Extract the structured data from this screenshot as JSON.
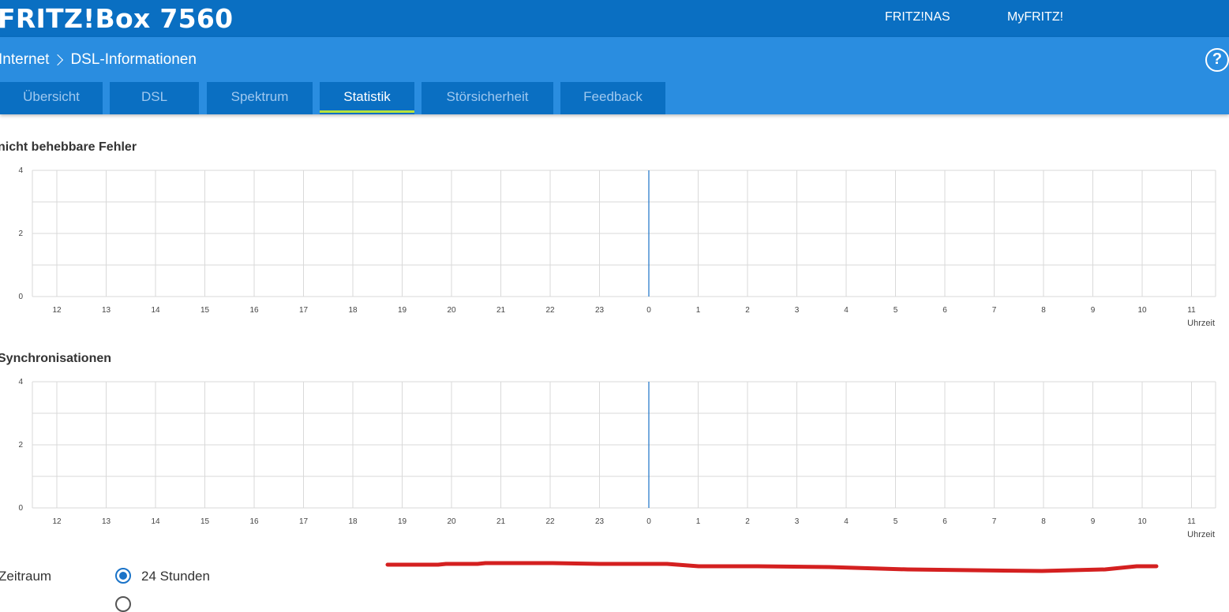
{
  "header": {
    "brand": "FRITZ!Box 7560",
    "links": [
      "FRITZ!NAS",
      "MyFRITZ!"
    ]
  },
  "breadcrumb": {
    "parent": "Internet",
    "current": "DSL-Informationen"
  },
  "help": {
    "label": "?"
  },
  "tabs": [
    {
      "label": "Übersicht",
      "active": false
    },
    {
      "label": "DSL",
      "active": false
    },
    {
      "label": "Spektrum",
      "active": false
    },
    {
      "label": "Statistik",
      "active": true
    },
    {
      "label": "Störsicherheit",
      "active": false
    },
    {
      "label": "Feedback",
      "active": false
    }
  ],
  "sections": {
    "errors_title": "nicht behebbare Fehler",
    "sync_title": "Synchronisationen"
  },
  "chart_data": [
    {
      "type": "line",
      "title": "nicht behebbare Fehler",
      "xlabel": "Uhrzeit",
      "categories": [
        "12",
        "13",
        "14",
        "15",
        "16",
        "17",
        "18",
        "19",
        "20",
        "21",
        "22",
        "23",
        "0",
        "1",
        "2",
        "3",
        "4",
        "5",
        "6",
        "7",
        "8",
        "9",
        "10",
        "11"
      ],
      "y_ticks": [
        0,
        2,
        4
      ],
      "ylim": [
        0,
        4
      ],
      "series": [],
      "day_marker": "0",
      "grid": true,
      "colors": {
        "grid": "#d9d9d9",
        "marker": "#1a73c8"
      }
    },
    {
      "type": "line",
      "title": "Synchronisationen",
      "xlabel": "Uhrzeit",
      "categories": [
        "12",
        "13",
        "14",
        "15",
        "16",
        "17",
        "18",
        "19",
        "20",
        "21",
        "22",
        "23",
        "0",
        "1",
        "2",
        "3",
        "4",
        "5",
        "6",
        "7",
        "8",
        "9",
        "10",
        "11"
      ],
      "y_ticks": [
        0,
        2,
        4
      ],
      "ylim": [
        0,
        4
      ],
      "series": [],
      "day_marker": "0",
      "grid": true,
      "colors": {
        "grid": "#d9d9d9",
        "marker": "#1a73c8"
      }
    }
  ],
  "timerange": {
    "label": "Zeitraum",
    "options": [
      {
        "label": "24 Stunden",
        "checked": true
      }
    ]
  },
  "colors": {
    "header": "#0a6fc2",
    "subheader": "#2a8de0",
    "tab_active_underline": "#b9e33a",
    "annotation": "#d42020"
  }
}
